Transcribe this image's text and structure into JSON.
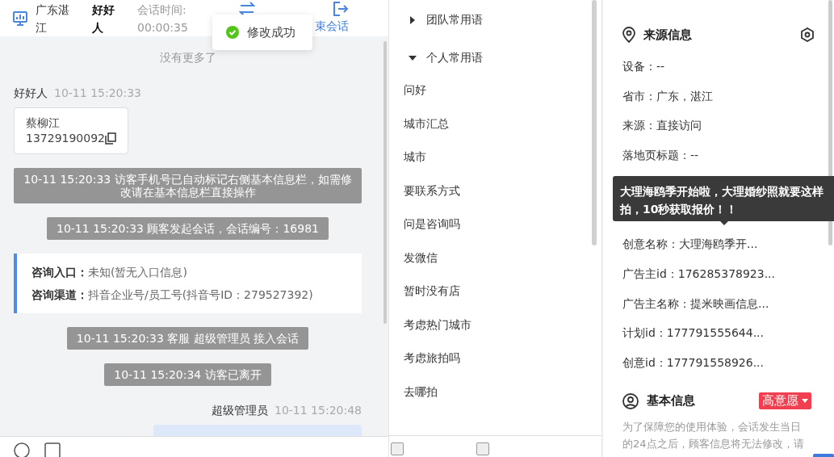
{
  "header": {
    "location": "广东湛江",
    "visitor": "好好人",
    "timer_label": "会话时间:",
    "timer": "00:00:35",
    "end_label": "束会话"
  },
  "toast": {
    "text": "修改成功"
  },
  "chat": [
    {
      "kind": "note",
      "text": "没有更多了"
    },
    {
      "kind": "sender",
      "name": "好好人",
      "time": "10-11 15:20:33"
    },
    {
      "kind": "card",
      "name": "蔡柳江",
      "phone": "13729190092"
    },
    {
      "kind": "system",
      "text": "10-11 15:20:33 访客手机号已自动标记右侧基本信息栏，如需修改请在基本信息栏直接操作"
    },
    {
      "kind": "system",
      "text": "10-11 15:20:33 顾客发起会话，会话编号：16981"
    },
    {
      "kind": "entry",
      "rows": [
        {
          "label": "咨询入口：",
          "value": "未知(暂无入口信息)"
        },
        {
          "label": "咨询渠道：",
          "value": "抖音企业号/员工号(抖音号ID：279527392)"
        }
      ]
    },
    {
      "kind": "system",
      "text": "10-11 15:20:33 客服 超级管理员 接入会话"
    },
    {
      "kind": "system",
      "text": "10-11 15:20:34 访客已离开"
    },
    {
      "kind": "my-sender",
      "name": "超级管理员",
      "time": "10-11 15:20:48"
    },
    {
      "kind": "bubble"
    }
  ],
  "phrases": {
    "groups": [
      {
        "title": "团队常用语",
        "expanded": false
      },
      {
        "title": "个人常用语",
        "expanded": true,
        "children": [
          "问好",
          "城市汇总",
          "城市",
          "要联系方式",
          "问是咨询吗",
          "发微信",
          "暂时没有店",
          "考虑热门城市",
          "考虑旅拍吗",
          "去哪拍"
        ]
      }
    ],
    "footer_checkboxes": [
      {
        "checked": false
      },
      {
        "checked": false
      }
    ]
  },
  "source_info": {
    "title": "来源信息",
    "rows": [
      {
        "label": "设备：",
        "value": "--"
      },
      {
        "label": "省市：",
        "value": "广东，湛江"
      },
      {
        "label": "来源：",
        "value": "直接访问"
      },
      {
        "label": "落地页标题：",
        "value": "--"
      },
      {
        "label": "创意名称：",
        "value": "大理海鸥季开..."
      },
      {
        "label": "广告主id：",
        "value": "176285378923..."
      },
      {
        "label": "广告主名称：",
        "value": "提米映画信息..."
      },
      {
        "label": "计划id：",
        "value": "177791555644..."
      },
      {
        "label": "创意id：",
        "value": "177791558926..."
      }
    ]
  },
  "tooltip": {
    "text": "大理海鸥季开始啦，大理婚纱照就要这样拍，10秒获取报价！！"
  },
  "basic_info": {
    "title": "基本信息",
    "tag": "高意愿",
    "notice": "为了保障您的使用体验，会话发生当日的24点之后，顾客信息将无法修改，请"
  }
}
